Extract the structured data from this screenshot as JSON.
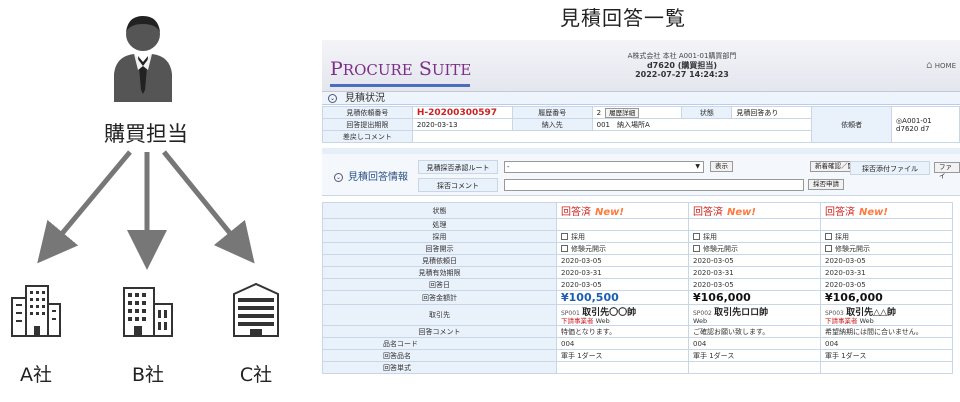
{
  "diagram": {
    "buyer_label": "購買担当",
    "companies": [
      "A社",
      "B社",
      "C社"
    ]
  },
  "page_title": "見積回答一覧",
  "app": {
    "logo_big_1": "P",
    "logo_small_1": "ROCURE",
    "logo_big_2": "S",
    "logo_small_2": "UITE",
    "header_line1": "A株式会社 本社 A001-01購買部門",
    "header_line2": "d7620 (購買担当)",
    "header_line3": "2022-07-27 14:24:23",
    "home_label": "HOME",
    "section_title": "見積状況",
    "status": {
      "req_no_label": "見積依頼番号",
      "req_no": "H-20200300597",
      "history_label": "履歴番号",
      "history_no": "2",
      "history_btn": "履歴詳細",
      "state_label": "状態",
      "state_value": "見積回答あり",
      "deadline_label": "回答提出期限",
      "deadline": "2020-03-13",
      "delivery_label": "納入先",
      "delivery_value": "001　納入場所A",
      "requester_label": "依頼者",
      "requester_value": "A001-01",
      "requester_value2": "d7620 d7",
      "return_comment_label": "差戻しコメント"
    },
    "kaito": {
      "section_label": "見積回答情報",
      "route_label": "見積採否承認ルート",
      "route_value": "-",
      "display_btn": "表示",
      "new_register_btn": "新着確認／開示",
      "attach_label": "採否添付ファイル",
      "file_btn": "ファイ",
      "comment_label": "採否コメント",
      "apply_btn": "採否申請"
    },
    "rows": {
      "state": "状態",
      "process": "処理",
      "adopt": "採用",
      "disclose": "回答開示",
      "req_date": "見積依頼日",
      "valid_until": "見積有効期限",
      "answer_date": "回答日",
      "total": "回答金額計",
      "supplier": "取引先",
      "comment": "回答コメント",
      "item_code": "品名コード",
      "item_name": "回答品名",
      "answer_format": "回答単式"
    },
    "quotes": [
      {
        "state": "回答済",
        "new": "New!",
        "adopt": "採用",
        "disclose": "修験元開示",
        "req_date": "2020-03-05",
        "valid_until": "2020-03-31",
        "answer_date": "2020-03-05",
        "total": "¥100,500",
        "sup_code": "SP001",
        "sup_name": "取引先〇〇帥",
        "sup_sub": "下請事業者",
        "sup_web": "Web",
        "comment": "特価となります。",
        "item_code": "004",
        "item_name": "軍手 1ダース"
      },
      {
        "state": "回答済",
        "new": "New!",
        "adopt": "採用",
        "disclose": "修験元開示",
        "req_date": "2020-03-05",
        "valid_until": "2020-03-31",
        "answer_date": "2020-03-05",
        "total": "¥106,000",
        "sup_code": "SP002",
        "sup_name": "取引先ロロ帥",
        "sup_sub": "",
        "sup_web": "Web",
        "comment": "ご確認お願い致します。",
        "item_code": "004",
        "item_name": "軍手 1ダース"
      },
      {
        "state": "回答済",
        "new": "New!",
        "adopt": "採用",
        "disclose": "修験元開示",
        "req_date": "2020-03-05",
        "valid_until": "2020-03-31",
        "answer_date": "2020-03-05",
        "total": "¥106,000",
        "sup_code": "SP003",
        "sup_name": "取引先△△帥",
        "sup_sub": "下請事業者",
        "sup_web": "Web",
        "comment": "希望納期には間に合いません。",
        "item_code": "004",
        "item_name": "軍手 1ダース"
      }
    ],
    "colors": {
      "accent": "#7b2f87",
      "new_badge": "#ff7a3d",
      "answered": "#d0211c",
      "label_bg": "#e9f1fb"
    }
  }
}
